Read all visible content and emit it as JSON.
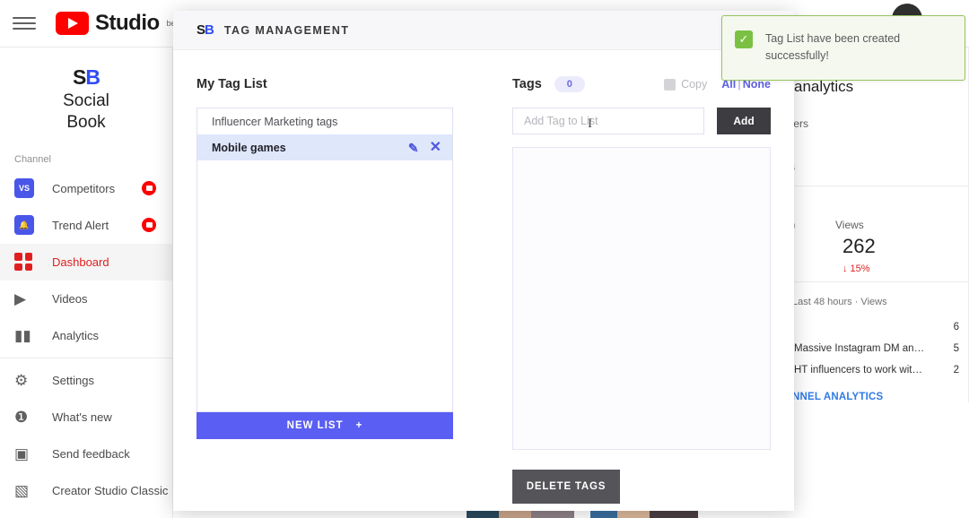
{
  "topbar": {
    "menu_icon": "hamburger-icon",
    "logo_text": "Studio",
    "logo_beta": "beta"
  },
  "sidebar": {
    "brand_mark": "SB",
    "brand_line1": "Social",
    "brand_line2": "Book",
    "section_label": "Channel",
    "items": [
      {
        "label": "Competitors",
        "icon": "vs-icon",
        "badge": true,
        "active": false
      },
      {
        "label": "Trend Alert",
        "icon": "bell-icon",
        "badge": true,
        "active": false
      },
      {
        "label": "Dashboard",
        "icon": "dashboard-grid-icon",
        "badge": false,
        "active": true
      },
      {
        "label": "Videos",
        "icon": "video-icon",
        "badge": false,
        "active": false
      },
      {
        "label": "Analytics",
        "icon": "bar-chart-icon",
        "badge": false,
        "active": false
      },
      {
        "label": "Settings",
        "icon": "gear-icon",
        "badge": false,
        "active": false
      },
      {
        "label": "What's new",
        "icon": "alert-badge-icon",
        "badge": false,
        "active": false
      },
      {
        "label": "Send feedback",
        "icon": "feedback-icon",
        "badge": false,
        "active": false
      },
      {
        "label": "Creator Studio Classic",
        "icon": "classic-studio-icon",
        "badge": false,
        "active": false
      }
    ]
  },
  "right_panel": {
    "title": "analytics",
    "subscribers_label": "cribers",
    "days_label": "days",
    "metric_left_label": "min)",
    "metric_right_label": "Views",
    "metric_value": "262",
    "metric_delta": "↓ 15%",
    "list_caption": "Last 48 hours · Views",
    "rows": [
      {
        "title": "",
        "value": "6"
      },
      {
        "title": "Massive Instagram DM an…",
        "value": "5"
      },
      {
        "title": "HT influencers to work wit…",
        "value": "2"
      }
    ],
    "link": "NNEL ANALYTICS"
  },
  "modal": {
    "logo_mark": "SB",
    "title": "TAG MANAGEMENT",
    "left": {
      "heading": "My Tag List",
      "lists": [
        {
          "name": "Influencer Marketing tags",
          "selected": false
        },
        {
          "name": "Mobile games",
          "selected": true
        }
      ],
      "edit_icon": "edit-pencil-icon",
      "remove_icon": "close-x-icon",
      "new_list_label": "NEW LIST",
      "new_list_plus": "+"
    },
    "right": {
      "heading": "Tags",
      "count_badge": "0",
      "copy_label": "Copy",
      "select_all_label": "All",
      "select_separator": "|",
      "select_none_label": "None",
      "input_placeholder": "Add Tag to List",
      "input_value": "",
      "add_label": "Add",
      "delete_label": "DELETE TAGS"
    }
  },
  "toast": {
    "icon": "check-icon",
    "check_glyph": "✓",
    "message": "Tag List have been created successfully!",
    "border_color": "#95c261",
    "icon_color": "#7ac143"
  }
}
